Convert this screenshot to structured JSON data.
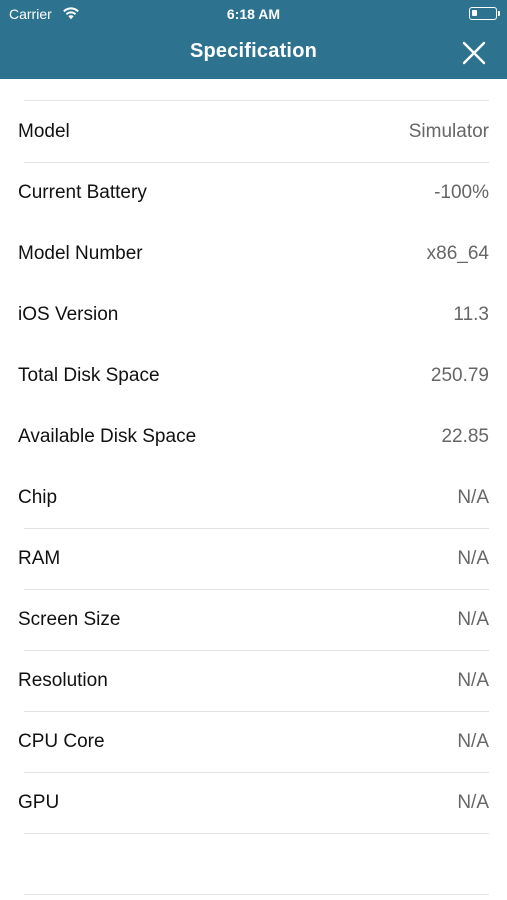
{
  "status_bar": {
    "carrier": "Carrier",
    "time": "6:18 AM"
  },
  "nav": {
    "title": "Specification"
  },
  "rows": [
    {
      "label": "Model",
      "value": "Simulator"
    },
    {
      "label": "Current Battery",
      "value": "-100%"
    },
    {
      "label": "Model Number",
      "value": "x86_64"
    },
    {
      "label": "iOS Version",
      "value": "11.3"
    },
    {
      "label": "Total Disk Space",
      "value": "250.79"
    },
    {
      "label": "Available Disk Space",
      "value": "22.85"
    },
    {
      "label": "Chip",
      "value": "N/A"
    },
    {
      "label": "RAM",
      "value": "N/A"
    },
    {
      "label": "Screen Size",
      "value": "N/A"
    },
    {
      "label": "Resolution",
      "value": "N/A"
    },
    {
      "label": "CPU Core",
      "value": "N/A"
    },
    {
      "label": "GPU",
      "value": "N/A"
    }
  ],
  "colors": {
    "header_bg": "#2d7390",
    "header_text": "#ffffff",
    "label": "#111111",
    "value": "#666666",
    "separator": "#e2e2e2"
  },
  "icons": {
    "wifi": "wifi-icon",
    "battery": "battery-icon",
    "close": "close-icon"
  }
}
